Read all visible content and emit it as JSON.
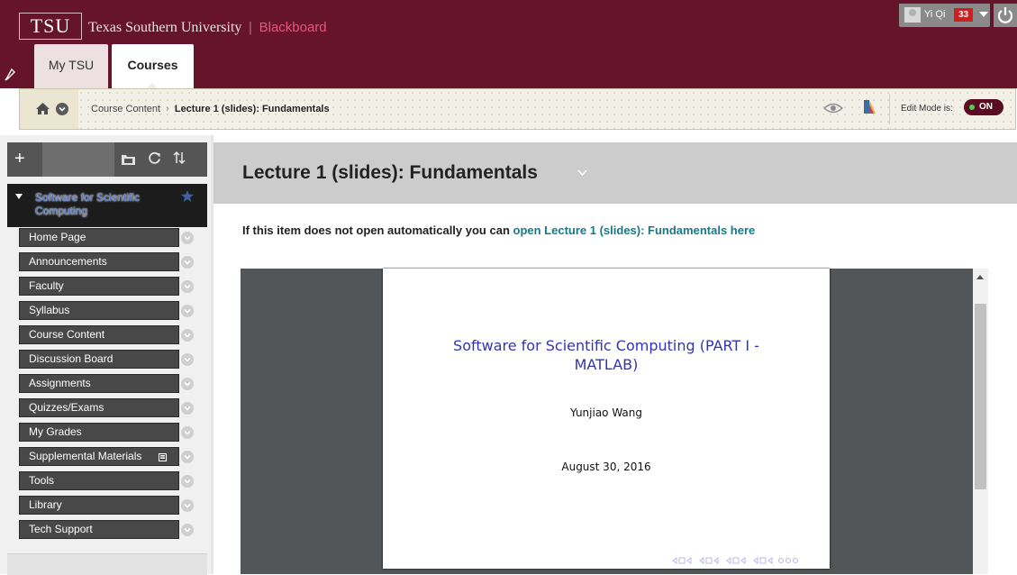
{
  "header": {
    "logo_text": "TSU",
    "university_name": "Texas Southern University",
    "separator": "|",
    "platform": "Blackboard",
    "tabs": [
      {
        "label": "My TSU",
        "active": false
      },
      {
        "label": "Courses",
        "active": true
      }
    ],
    "user": {
      "name": "Yi Qi",
      "notifications": "33"
    },
    "colors": {
      "brand": "#66132c",
      "accent": "#e8577a"
    }
  },
  "breadcrumb": {
    "parent": "Course Content",
    "separator": "›",
    "current": "Lecture 1 (slides): Fundamentals",
    "edit_mode_label": "Edit Mode is:",
    "edit_mode_state": "ON"
  },
  "sidebar": {
    "course_title": "Software for Scientific Computing",
    "items": [
      {
        "label": "Home Page"
      },
      {
        "label": "Announcements"
      },
      {
        "label": "Faculty"
      },
      {
        "label": "Syllabus"
      },
      {
        "label": "Course Content"
      },
      {
        "label": "Discussion Board"
      },
      {
        "label": "Assignments"
      },
      {
        "label": "Quizzes/Exams"
      },
      {
        "label": "My Grades"
      },
      {
        "label": "Supplemental Materials"
      },
      {
        "label": "Tools"
      },
      {
        "label": "Library"
      },
      {
        "label": "Tech Support"
      }
    ]
  },
  "main": {
    "title": "Lecture 1 (slides): Fundamentals",
    "open_prefix": "If this item does not open automatically you can",
    "open_link": "open Lecture 1 (slides): Fundamentals here",
    "link_color": "#167a86"
  },
  "slide": {
    "title_line1": "Software for Scientific Computing (PART I -",
    "title_line2": "MATLAB)",
    "author": "Yunjiao Wang",
    "date": "August 30, 2016",
    "title_color": "#3434b2"
  }
}
